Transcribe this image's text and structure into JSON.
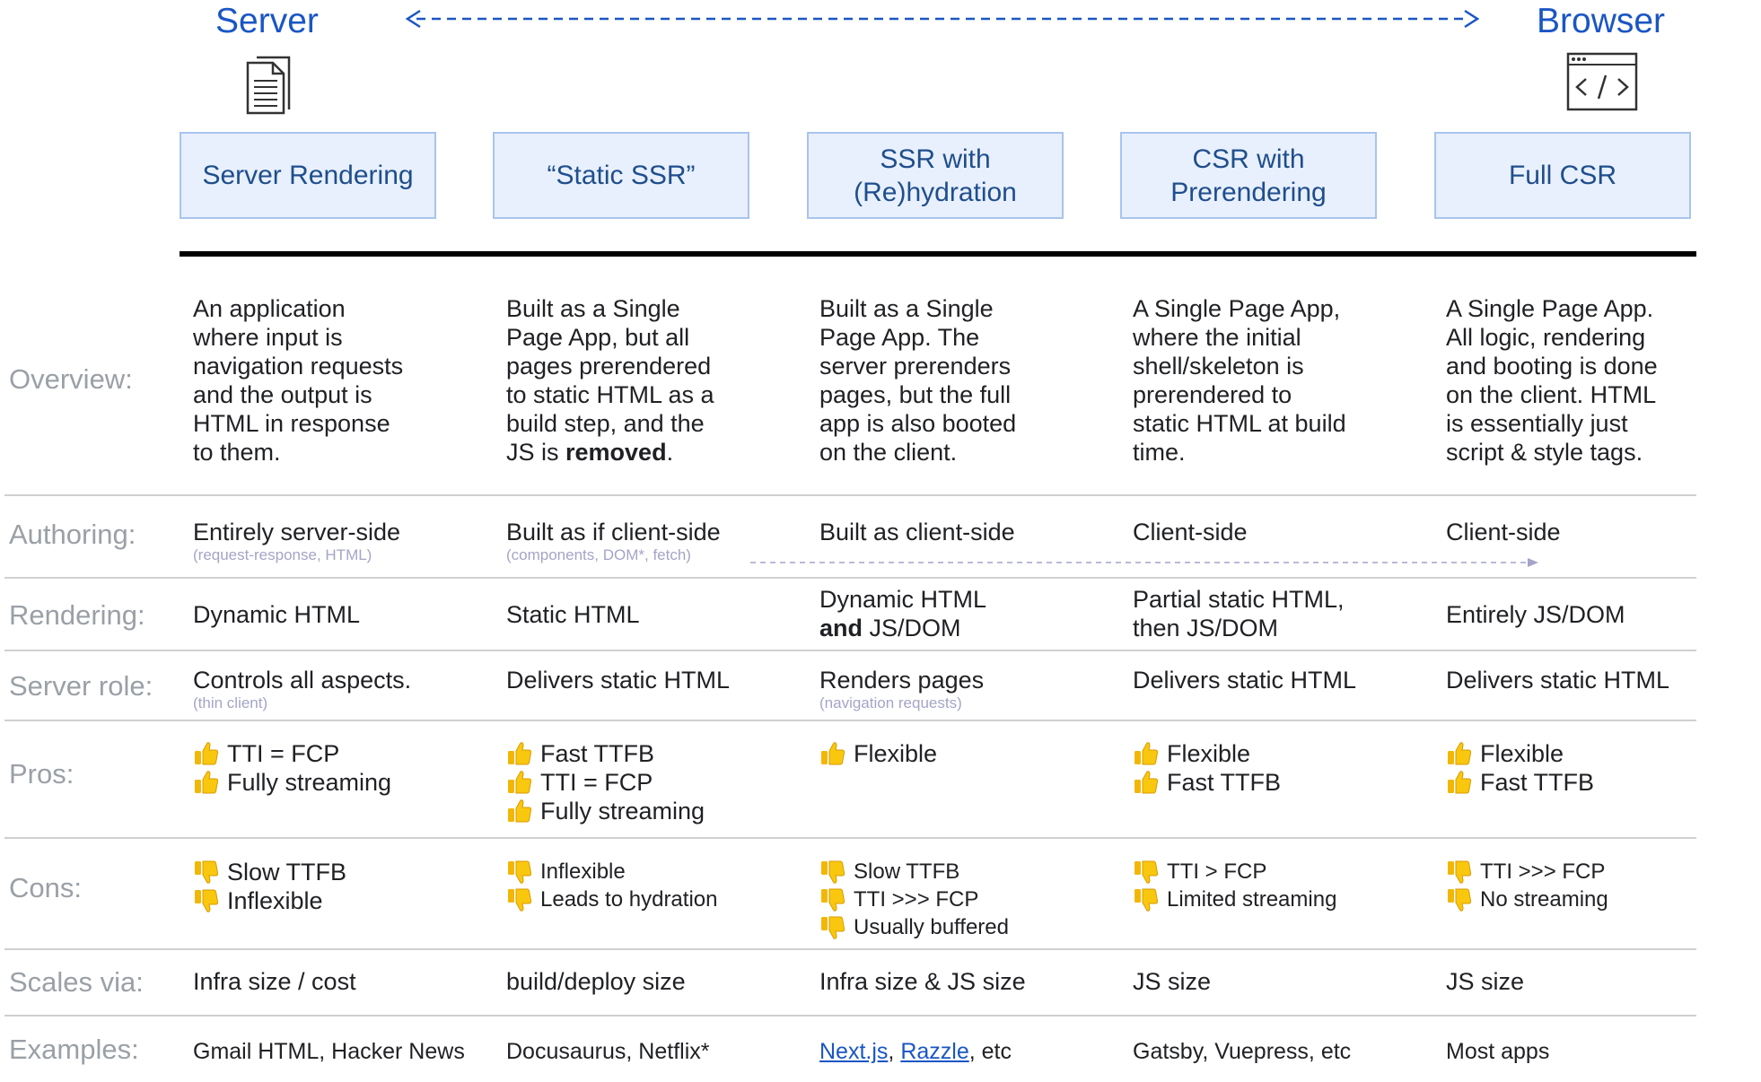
{
  "spectrum": {
    "left": "Server",
    "right": "Browser"
  },
  "icons": {
    "server": "document-stack-icon",
    "browser": "code-window-icon",
    "pro": "thumbs-up-icon",
    "con": "thumbs-down-icon"
  },
  "colors": {
    "accent": "#1a56c4",
    "box_bg": "#e8f0fe",
    "box_border": "#a8c4ee",
    "label": "#9aa0a6",
    "thumb": "#f2b705"
  },
  "categories": [
    "Server Rendering",
    "“Static SSR”",
    "SSR with\n(Re)hydration",
    "CSR with\nPrerendering",
    "Full CSR"
  ],
  "row_labels": {
    "overview": "Overview:",
    "authoring": "Authoring:",
    "rendering": "Rendering:",
    "server_role": "Server role:",
    "pros": "Pros:",
    "cons": "Cons:",
    "scales": "Scales via:",
    "examples": "Examples:"
  },
  "overview": [
    {
      "text": "An application\nwhere input is\nnavigation requests\nand the output is\nHTML in response\nto them."
    },
    {
      "text": "Built as a Single\nPage App, but all\npages prerendered\nto static HTML as a\nbuild step, and the\nJS is ",
      "bold": "removed",
      "after": "."
    },
    {
      "text": "Built as a Single\nPage App. The\nserver prerenders\npages, but the full\napp is also booted\non the client."
    },
    {
      "text": "A Single Page App,\nwhere the initial\nshell/skeleton is\nprerendered to\nstatic HTML at build\ntime."
    },
    {
      "text": "A Single Page App.\nAll logic, rendering\nand booting is done\non the client. HTML\nis essentially just\nscript & style tags."
    }
  ],
  "authoring": [
    {
      "main": "Entirely server-side",
      "sub": "(request-response, HTML)"
    },
    {
      "main": "Built as if client-side",
      "sub": "(components, DOM*, fetch)"
    },
    {
      "main": "Built as client-side",
      "sub": ""
    },
    {
      "main": "Client-side",
      "sub": ""
    },
    {
      "main": "Client-side",
      "sub": ""
    }
  ],
  "rendering": [
    {
      "line1": "Dynamic HTML",
      "bold": "",
      "line2": ""
    },
    {
      "line1": "Static HTML",
      "bold": "",
      "line2": ""
    },
    {
      "line1": "Dynamic HTML",
      "bold": "and",
      "line2": " JS/DOM"
    },
    {
      "line1": "Partial static HTML,",
      "bold": "",
      "line2": "then JS/DOM"
    },
    {
      "line1": "Entirely JS/DOM",
      "bold": "",
      "line2": ""
    }
  ],
  "server_role": [
    {
      "main": "Controls all aspects.",
      "sub": "(thin client)"
    },
    {
      "main": "Delivers static HTML",
      "sub": ""
    },
    {
      "main": "Renders pages",
      "sub": "(navigation requests)"
    },
    {
      "main": "Delivers static HTML",
      "sub": ""
    },
    {
      "main": "Delivers static HTML",
      "sub": ""
    }
  ],
  "pros": [
    [
      "TTI = FCP",
      "Fully streaming"
    ],
    [
      "Fast TTFB",
      "TTI = FCP",
      "Fully streaming"
    ],
    [
      "Flexible"
    ],
    [
      "Flexible",
      "Fast TTFB"
    ],
    [
      "Flexible",
      "Fast TTFB"
    ]
  ],
  "cons": [
    [
      "Slow TTFB",
      "Inflexible"
    ],
    [
      "Inflexible",
      "Leads to hydration"
    ],
    [
      "Slow TTFB",
      "TTI >>> FCP",
      "Usually buffered"
    ],
    [
      "TTI > FCP",
      "Limited streaming"
    ],
    [
      "TTI >>> FCP",
      "No streaming"
    ]
  ],
  "scales": [
    "Infra size / cost",
    "build/deploy size",
    "Infra size & JS size",
    "JS size",
    "JS size"
  ],
  "examples": {
    "col1": "Gmail HTML, Hacker News",
    "col2": "Docusaurus, Netflix*",
    "col3_link1": "Next.js",
    "col3_sep": ", ",
    "col3_link2": "Razzle",
    "col3_rest": ", etc",
    "col4": "Gatsby, Vuepress, etc",
    "col5": "Most apps"
  }
}
